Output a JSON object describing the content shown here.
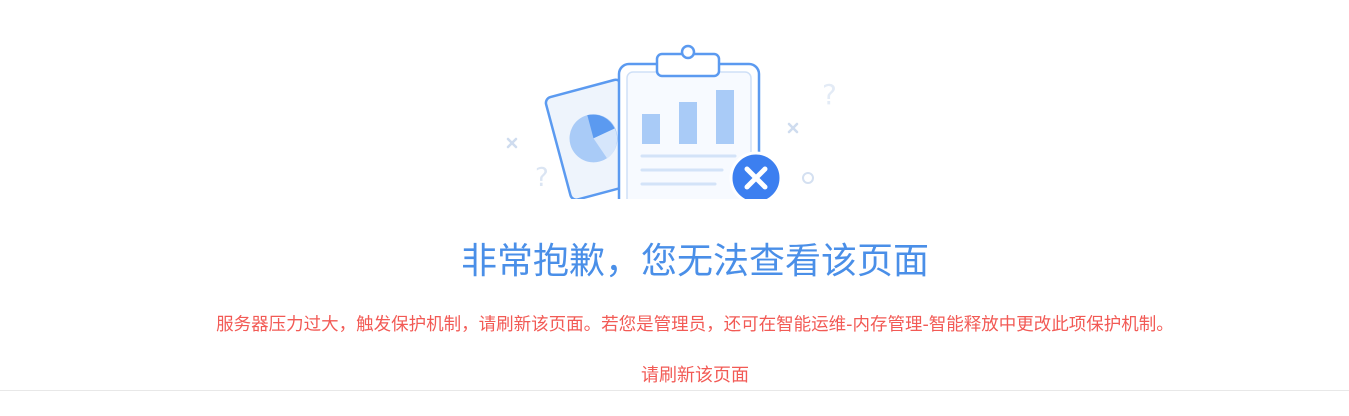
{
  "error": {
    "title": "非常抱歉，您无法查看该页面",
    "message": "服务器压力过大，触发保护机制，请刷新该页面。若您是管理员，还可在智能运维-内存管理-智能释放中更改此项保护机制。",
    "refresh_label": "请刷新该页面"
  },
  "icons": [
    "clipboard-chart-illustration",
    "error-x-icon",
    "question-mark-icon",
    "cross-mark-icon",
    "pie-chart-card-icon"
  ],
  "colors": {
    "title": "#4a8fe8",
    "message": "#f25a55",
    "accent": "#3c7ff0"
  }
}
